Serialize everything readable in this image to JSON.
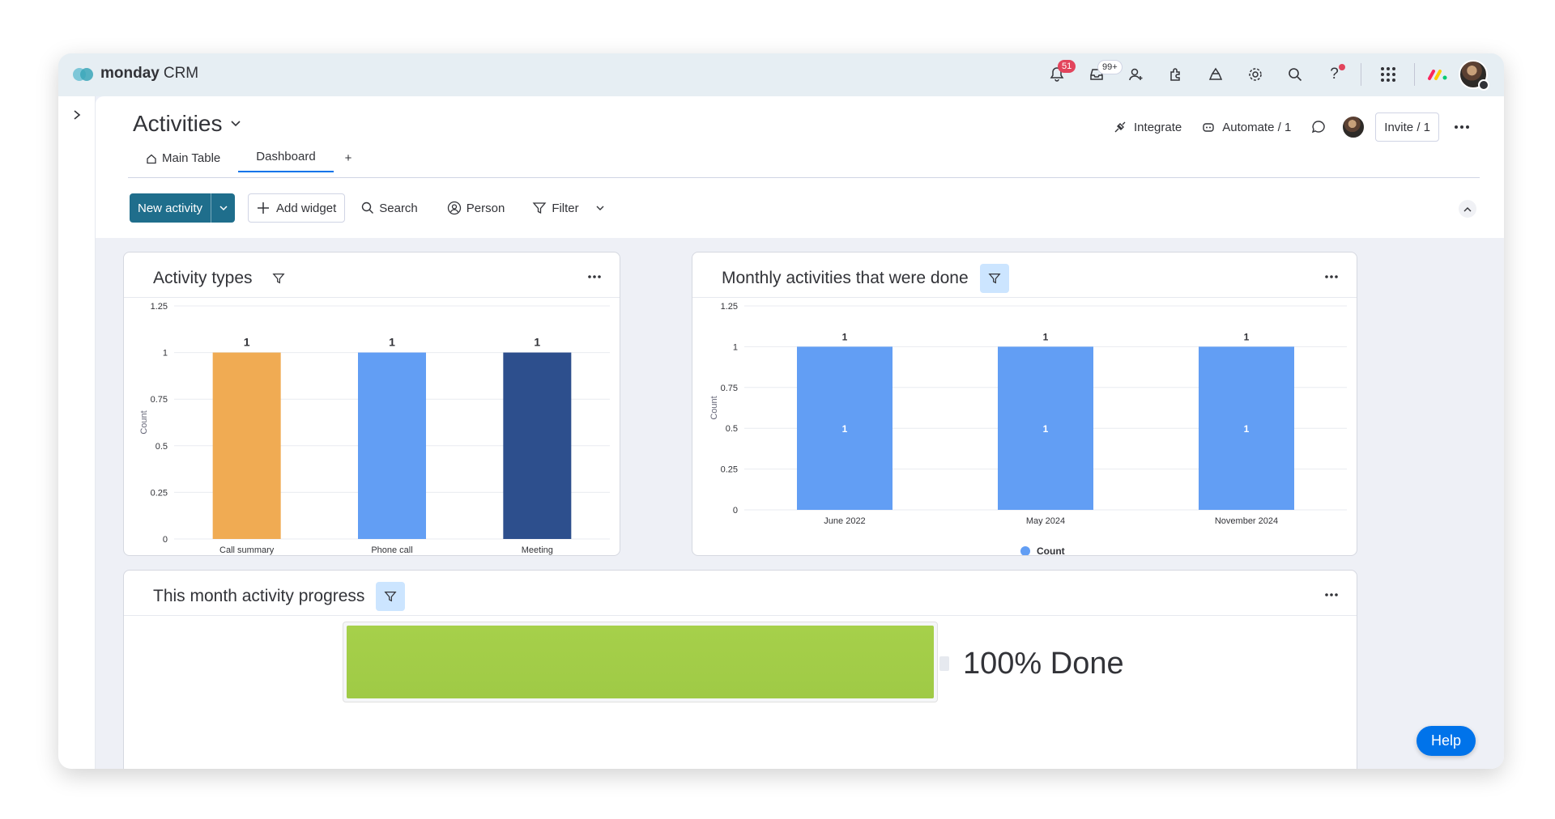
{
  "app": {
    "brand": "monday",
    "product": "CRM"
  },
  "topbar": {
    "notifications_badge": "51",
    "inbox_badge": "99+",
    "icons": [
      "bell-icon",
      "inbox-icon",
      "invite-user-icon",
      "apps-puzzle-icon",
      "marketplace-icon",
      "settings-gear-icon",
      "search-icon",
      "help-question-icon",
      "apps-grid-icon"
    ]
  },
  "board": {
    "title": "Activities",
    "integrate_label": "Integrate",
    "automate_label": "Automate / 1",
    "invite_label": "Invite / 1"
  },
  "tabs": [
    {
      "label": "Main Table",
      "active": false
    },
    {
      "label": "Dashboard",
      "active": true
    }
  ],
  "add_tab_label": "+",
  "toolbar": {
    "new_label": "New activity",
    "add_widget_label": "Add widget",
    "search_label": "Search",
    "person_label": "Person",
    "filter_label": "Filter"
  },
  "widgets": {
    "activity_types": {
      "title": "Activity types"
    },
    "monthly": {
      "title": "Monthly activities that were done"
    },
    "progress": {
      "title": "This month activity progress",
      "label": "100% Done",
      "value": 1.0
    }
  },
  "chart_data": [
    {
      "type": "bar",
      "title": "Activity types",
      "categories": [
        "Call summary",
        "Phone call",
        "Meeting"
      ],
      "values": [
        1,
        1,
        1
      ],
      "colors": [
        "#f0ab53",
        "#629ef4",
        "#2d4f8d"
      ],
      "ylabel": "Count",
      "ylim": [
        0,
        1.25
      ],
      "yticks": [
        "0",
        "0.25",
        "0.5",
        "0.75",
        "1",
        "1.25"
      ],
      "data_labels": [
        "1",
        "1",
        "1"
      ]
    },
    {
      "type": "bar",
      "title": "Monthly activities that were done",
      "categories": [
        "June 2022",
        "May 2024",
        "November 2024"
      ],
      "series": [
        {
          "name": "Count",
          "values": [
            1,
            1,
            1
          ],
          "color": "#629ef4"
        }
      ],
      "ylabel": "Count",
      "ylim": [
        0,
        1.25
      ],
      "yticks": [
        "0",
        "0.25",
        "0.5",
        "0.75",
        "1",
        "1.25"
      ],
      "data_labels": [
        "1",
        "1",
        "1"
      ],
      "legend": "bottom"
    }
  ],
  "help_label": "Help"
}
